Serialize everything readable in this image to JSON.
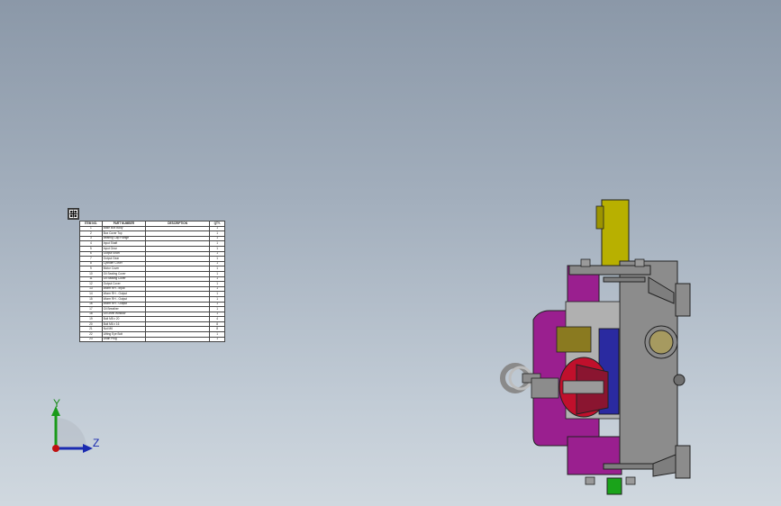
{
  "bom": {
    "headers": [
      "ITEM NO.",
      "PART NUMBER",
      "DESCRIPTION",
      "QTY."
    ],
    "rows": [
      {
        "item": "1",
        "part": "Base Box Body",
        "desc": "",
        "qty": "1"
      },
      {
        "item": "2",
        "part": "Box Cover Top",
        "desc": "",
        "qty": "1"
      },
      {
        "item": "3",
        "part": "Bearing Cap Flange",
        "desc": "",
        "qty": "1"
      },
      {
        "item": "4",
        "part": "Input Shaft",
        "desc": "",
        "qty": "1"
      },
      {
        "item": "5",
        "part": "Input Gear",
        "desc": "",
        "qty": "1"
      },
      {
        "item": "6",
        "part": "Output Shaft",
        "desc": "",
        "qty": "1"
      },
      {
        "item": "7",
        "part": "Output Gear",
        "desc": "",
        "qty": "1"
      },
      {
        "item": "8",
        "part": "Cylinder Cover",
        "desc": "",
        "qty": "1"
      },
      {
        "item": "9",
        "part": "Motor Cover",
        "desc": "",
        "qty": "1"
      },
      {
        "item": "10",
        "part": "Oil Sealing Cover",
        "desc": "",
        "qty": "1"
      },
      {
        "item": "11",
        "part": "Oil Sealing Cover",
        "desc": "",
        "qty": "1"
      },
      {
        "item": "12",
        "part": "Output Cover",
        "desc": "",
        "qty": "1"
      },
      {
        "item": "13",
        "part": "Worm RH - Input",
        "desc": "",
        "qty": "1"
      },
      {
        "item": "14",
        "part": "Worm RH - Output",
        "desc": "",
        "qty": "1"
      },
      {
        "item": "15",
        "part": "Worm RH - Output",
        "desc": "",
        "qty": "1"
      },
      {
        "item": "16",
        "part": "Worm RH - Output",
        "desc": "",
        "qty": "1"
      },
      {
        "item": "17",
        "part": "Oil Breather",
        "desc": "",
        "qty": "1"
      },
      {
        "item": "18",
        "part": "Oil Level Window",
        "desc": "",
        "qty": "1"
      },
      {
        "item": "19",
        "part": "Bolt M8 x 20",
        "desc": "",
        "qty": "4"
      },
      {
        "item": "20",
        "part": "Bolt M6 x 16",
        "desc": "",
        "qty": "8"
      },
      {
        "item": "21",
        "part": "Nut M6",
        "desc": "",
        "qty": "8"
      },
      {
        "item": "22",
        "part": "Lifting Eye Bolt",
        "desc": "",
        "qty": "1"
      },
      {
        "item": "23",
        "part": "Drain Plug",
        "desc": "",
        "qty": "1"
      }
    ]
  },
  "triad": {
    "y_label": "Y",
    "z_label": "Z"
  },
  "colors": {
    "housing": "#8c8c8c",
    "motor_side": "#9a1f8f",
    "top_shaft": "#b8b000",
    "internal_blue": "#2a2aa0",
    "internal_red": "#c0102c",
    "drain_plug": "#1aa31a",
    "eye_bolt": "#a8a8a8"
  },
  "icons": [
    "move-table-icon",
    "coordinate-triad-icon"
  ]
}
